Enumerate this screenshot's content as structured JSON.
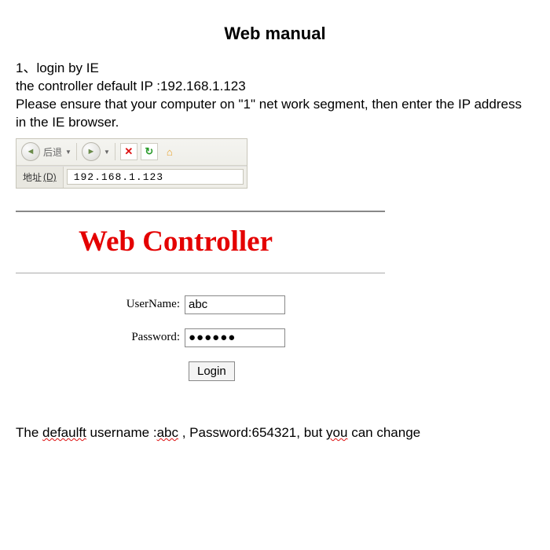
{
  "title": "Web manual",
  "instructions": {
    "line1": "1、login by IE",
    "line2": "the controller default IP :192.168.1.123",
    "line3": "Please ensure that your computer on \"1\" net work segment, then enter the IP address in the IE browser."
  },
  "ie_toolbar": {
    "back_label": "后退",
    "address_label": "地址",
    "address_shortcut": "(D)",
    "address_value": "192.168.1.123"
  },
  "web_controller": {
    "heading": "Web Controller",
    "username_label": "UserName:",
    "username_value": "abc",
    "password_label": "Password:",
    "password_value_masked": "●●●●●●",
    "login_label": "Login"
  },
  "footer": {
    "prefix": "The ",
    "defaulft": "defaulft",
    "mid1": " username :",
    "abc": "abc",
    "mid2": " , Password:654321, but ",
    "you": "you",
    "suffix": " can change"
  }
}
